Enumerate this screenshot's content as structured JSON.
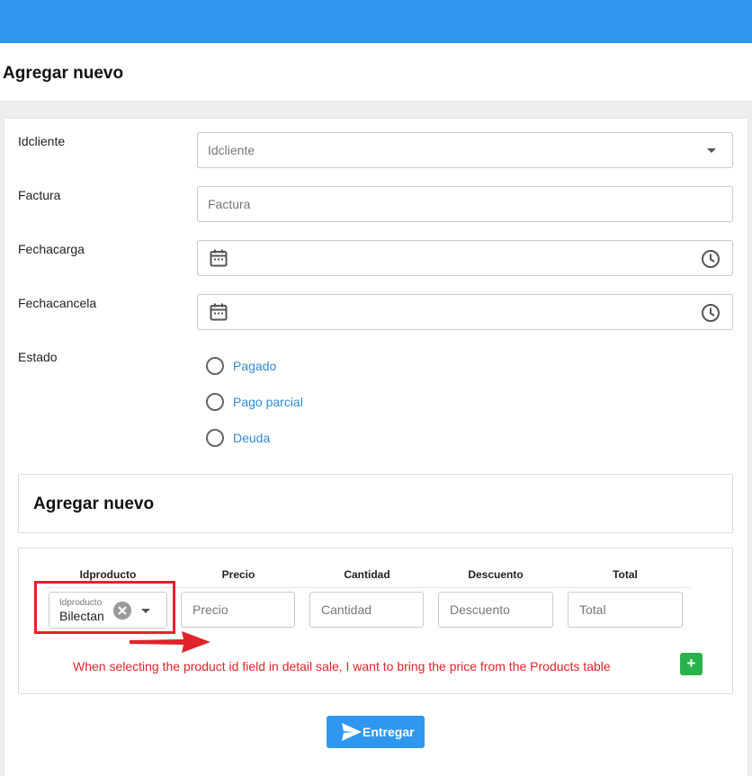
{
  "page": {
    "title": "Agregar nuevo"
  },
  "form": {
    "idcliente": {
      "label": "Idcliente",
      "placeholder": "Idcliente"
    },
    "factura": {
      "label": "Factura",
      "placeholder": "Factura"
    },
    "fechacarga": {
      "label": "Fechacarga",
      "icons": [
        "calendar-icon",
        "clock-icon"
      ]
    },
    "fechacancela": {
      "label": "Fechacancela",
      "icons": [
        "calendar-icon",
        "clock-icon"
      ]
    },
    "estado": {
      "label": "Estado",
      "options": [
        "Pagado",
        "Pago parcial",
        "Deuda"
      ],
      "option_color": "#2f8ad8"
    }
  },
  "detail": {
    "title": "Agregar nuevo",
    "columns": [
      "Idproducto",
      "Precio",
      "Cantidad",
      "Descuento",
      "Total"
    ],
    "row": {
      "idproducto": {
        "mini_label": "Idproducto",
        "value": "Bilectan"
      },
      "precio": {
        "placeholder": "Precio"
      },
      "cantidad": {
        "placeholder": "Cantidad"
      },
      "descuento": {
        "placeholder": "Descuento"
      },
      "total": {
        "placeholder": "Total"
      }
    },
    "add_label": "+",
    "annotation": "When selecting the product id field in detail sale, I want to bring the price from the Products table"
  },
  "submit": {
    "label": "Entregar",
    "icon": "send-icon"
  },
  "colors": {
    "primary": "#2f97ee",
    "success": "#2ab24a",
    "annotation_red": "#e0242a"
  }
}
